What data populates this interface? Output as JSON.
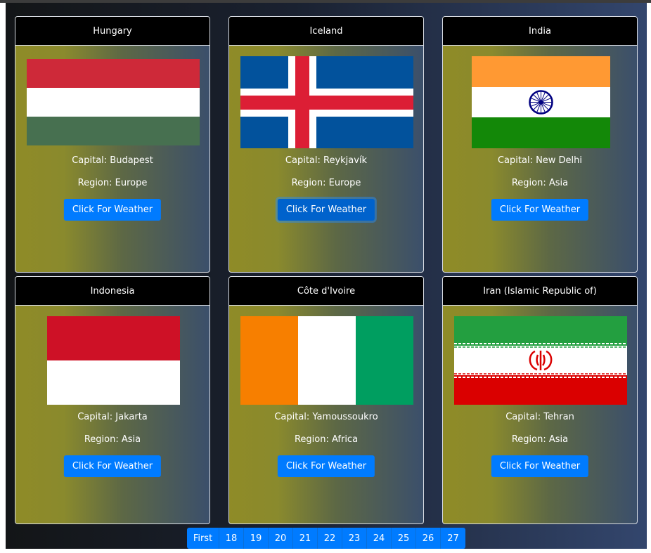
{
  "cards": [
    {
      "name": "Hungary",
      "capital": "Capital: Budapest",
      "region": "Region: Europe",
      "button": "Click For Weather"
    },
    {
      "name": "Iceland",
      "capital": "Capital: Reykjavík",
      "region": "Region: Europe",
      "button": "Click For Weather"
    },
    {
      "name": "India",
      "capital": "Capital: New Delhi",
      "region": "Region: Asia",
      "button": "Click For Weather"
    },
    {
      "name": "Indonesia",
      "capital": "Capital: Jakarta",
      "region": "Region: Asia",
      "button": "Click For Weather"
    },
    {
      "name": "Côte d'Ivoire",
      "capital": "Capital: Yamoussoukro",
      "region": "Region: Africa",
      "button": "Click For Weather"
    },
    {
      "name": "Iran (Islamic Republic of)",
      "capital": "Capital: Tehran",
      "region": "Region: Asia",
      "button": "Click For Weather"
    }
  ],
  "pagination": [
    "First",
    "18",
    "19",
    "20",
    "21",
    "22",
    "23",
    "24",
    "25",
    "26",
    "27"
  ],
  "colors": {
    "header_bg": "#000000",
    "button": "#007bff",
    "card_gradient_start": "#8f8b27",
    "card_gradient_end": "#3b4f6b"
  }
}
